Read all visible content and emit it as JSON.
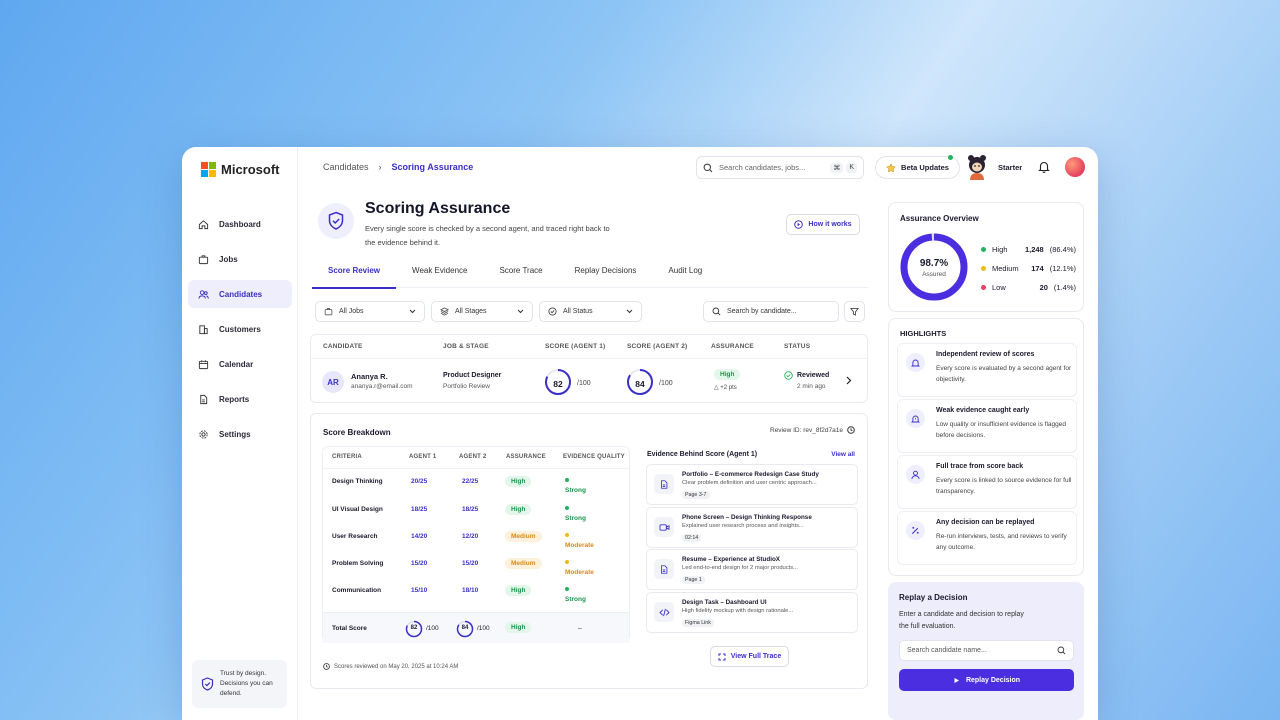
{
  "app": {
    "brand": "Microsoft"
  },
  "sidebar": {
    "items": [
      {
        "label": "Dashboard",
        "icon": "home-icon"
      },
      {
        "label": "Jobs",
        "icon": "briefcase-icon"
      },
      {
        "label": "Candidates",
        "icon": "users-icon",
        "active": true
      },
      {
        "label": "Customers",
        "icon": "building-icon"
      },
      {
        "label": "Calendar",
        "icon": "calendar-icon"
      },
      {
        "label": "Reports",
        "icon": "document-icon"
      },
      {
        "label": "Settings",
        "icon": "gear-icon"
      }
    ],
    "trust": {
      "line1": "Trust by design.",
      "line2": "Decisions you can",
      "line3": "defend."
    }
  },
  "topbar": {
    "breadcrumb": [
      "Candidates",
      "Scoring Assurance"
    ],
    "search_placeholder": "Search candidates, jobs...",
    "kbd": [
      "⌘",
      "K"
    ],
    "beta": "Beta Updates",
    "plan": "Starter"
  },
  "header": {
    "title": "Scoring Assurance",
    "subtitle": "Every single score is checked by a second agent, and traced right back to the evidence behind it.",
    "how": "How it works"
  },
  "tabs": [
    "Score Review",
    "Weak Evidence",
    "Score Trace",
    "Replay Decisions",
    "Audit Log"
  ],
  "filters": {
    "jobs": "All Jobs",
    "stages": "All Stages",
    "status": "All Status",
    "search": "Search by candidate..."
  },
  "table": {
    "headers": [
      "CANDIDATE",
      "JOB & STAGE",
      "SCORE (AGENT 1)",
      "SCORE (AGENT 2)",
      "ASSURANCE",
      "STATUS"
    ],
    "row": {
      "initials": "AR",
      "name": "Ananya R.",
      "email": "ananya.r@email.com",
      "job": "Product Designer",
      "stage": "Portfolio Review",
      "score1": "82",
      "score2": "84",
      "out_of": "/100",
      "score1_value": 82,
      "score2_value": 84,
      "assurance": "High",
      "delta": "+2 pts",
      "status": "Reviewed",
      "time": "2 min ago"
    }
  },
  "breakdown": {
    "title": "Score Breakdown",
    "review_id": "Review ID: rev_8f2d7a1e",
    "headers": [
      "CRITERIA",
      "AGENT 1",
      "AGENT 2",
      "ASSURANCE",
      "EVIDENCE QUALITY"
    ],
    "rows": [
      {
        "criteria": "Design Thinking",
        "a1": "20/25",
        "a2": "22/25",
        "assurance": "High",
        "quality": "Strong"
      },
      {
        "criteria": "UI Visual Design",
        "a1": "18/25",
        "a2": "18/25",
        "assurance": "High",
        "quality": "Strong"
      },
      {
        "criteria": "User Research",
        "a1": "14/20",
        "a2": "12/20",
        "assurance": "Medium",
        "quality": "Moderate"
      },
      {
        "criteria": "Problem Solving",
        "a1": "15/20",
        "a2": "15/20",
        "assurance": "Medium",
        "quality": "Moderate"
      },
      {
        "criteria": "Communication",
        "a1": "15/10",
        "a2": "18/10",
        "assurance": "High",
        "quality": "Strong"
      }
    ],
    "total": {
      "label": "Total Score",
      "a1": "82",
      "a2": "84",
      "out_of": "/100",
      "assurance": "High",
      "quality": "–"
    },
    "reviewed_on": "Scores reviewed on May 20, 2025 at 10:24 AM"
  },
  "evidence": {
    "title": "Evidence Behind Score (Agent 1)",
    "view_all": "View all",
    "items": [
      {
        "title": "Portfolio – E-commerce Redesign Case Study",
        "desc": "Clear problem definition and user centric approach...",
        "tag": "Page 3-7",
        "icon": "document-icon"
      },
      {
        "title": "Phone Screen – Design Thinking Response",
        "desc": "Explained user research process and insights...",
        "tag": "02:14",
        "icon": "video-icon"
      },
      {
        "title": "Resume – Experience at StudioX",
        "desc": "Led end-to-end design for 2 major products...",
        "tag": "Page 1",
        "icon": "document-icon"
      },
      {
        "title": "Design Task – Dashboard UI",
        "desc": "High fidelity mockup with design rationale...",
        "tag": "Figma Link",
        "icon": "code-icon"
      }
    ],
    "full_trace": "View Full Trace"
  },
  "overview": {
    "title": "Assurance Overview",
    "percent": "98.7%",
    "percent_value": 98.7,
    "label": "Assured",
    "legend": [
      {
        "name": "High",
        "value": "1,248",
        "pct": "(86.4%)",
        "color": "#22b35e"
      },
      {
        "name": "Medium",
        "value": "174",
        "pct": "(12.1%)",
        "color": "#f0b91a"
      },
      {
        "name": "Low",
        "value": "20",
        "pct": "(1.4%)",
        "color": "#e5405e"
      }
    ]
  },
  "highlights": {
    "title": "HIGHLIGHTS",
    "items": [
      {
        "title": "Independent review of scores",
        "desc": "Every score is evaluated by a second agent for objectivity."
      },
      {
        "title": "Weak evidence caught early",
        "desc": "Low quality or insufficient evidence is flagged before decisions."
      },
      {
        "title": "Full trace from score back",
        "desc": "Every score is linked to source evidence for full transparency."
      },
      {
        "title": "Any decision can be replayed",
        "desc": "Re-run interviews, tests, and reviews to verify any outcome."
      }
    ]
  },
  "replay": {
    "title": "Replay a Decision",
    "desc": "Enter a candidate and decision to replay the full evaluation.",
    "placeholder": "Search candidate name...",
    "button": "Replay Decision"
  },
  "colors": {
    "accent": "#3b2fc9",
    "button": "#4b2ee0",
    "high": "#22b35e",
    "medium": "#f0b91a",
    "low": "#e5405e"
  }
}
